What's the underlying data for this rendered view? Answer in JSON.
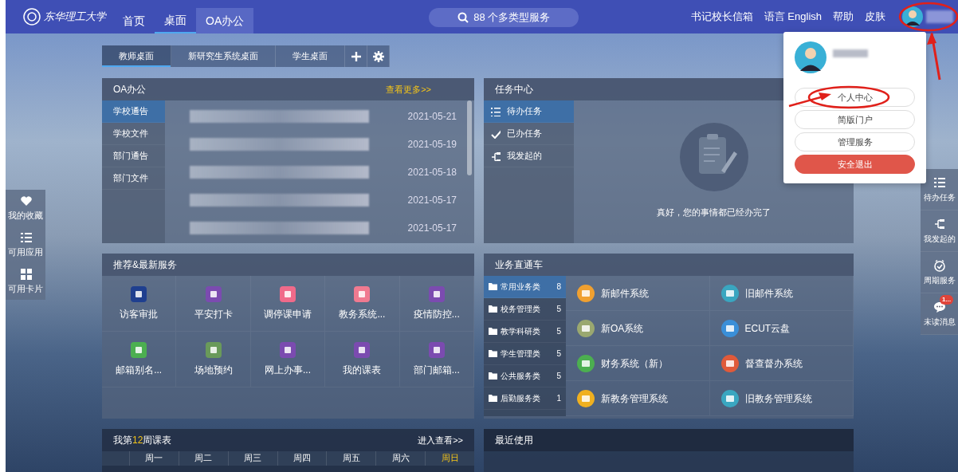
{
  "top_bar": {
    "logo": "东华理工大学",
    "nav": [
      {
        "label": "首页",
        "selected": false,
        "hovered": false
      },
      {
        "label": "桌面",
        "selected": true,
        "hovered": false
      },
      {
        "label": "OA办公",
        "selected": false,
        "hovered": true
      }
    ],
    "search": {
      "placeholder": "88 个多类型服务"
    },
    "links": [
      "书记校长信箱",
      "语言 English",
      "帮助",
      "皮肤"
    ]
  },
  "desk_tabs": [
    {
      "label": "教师桌面",
      "selected": true
    },
    {
      "label": "新研究生系统桌面",
      "selected": false
    },
    {
      "label": "学生桌面",
      "selected": false
    }
  ],
  "oa_panel": {
    "title": "OA办公",
    "more": "查看更多>>",
    "categories": [
      {
        "label": "学校通告",
        "selected": true
      },
      {
        "label": "学校文件",
        "selected": false
      },
      {
        "label": "部门通告",
        "selected": false
      },
      {
        "label": "部门文件",
        "selected": false
      }
    ],
    "items": [
      {
        "date": "2021-05-21"
      },
      {
        "date": "2021-05-19"
      },
      {
        "date": "2021-05-18"
      },
      {
        "date": "2021-05-17"
      },
      {
        "date": "2021-05-17"
      }
    ]
  },
  "task_center": {
    "title": "任务中心",
    "items": [
      {
        "label": "待办任务",
        "kind": "todo",
        "selected": true
      },
      {
        "label": "已办任务",
        "kind": "done",
        "selected": false
      },
      {
        "label": "我发起的",
        "kind": "started",
        "selected": false
      }
    ],
    "empty_message": "真好，您的事情都已经办完了"
  },
  "services": {
    "title": "推荐&最新服务",
    "items": [
      {
        "label": "访客审批",
        "color": "#1f3f8f"
      },
      {
        "label": "平安打卡",
        "color": "#7b4bb0"
      },
      {
        "label": "调停课申请",
        "color": "#f06a8a"
      },
      {
        "label": "教务系统...",
        "color": "#f07a90"
      },
      {
        "label": "疫情防控...",
        "color": "#7b4bb0"
      },
      {
        "label": "邮箱别名...",
        "color": "#4caf50"
      },
      {
        "label": "场地预约",
        "color": "#6a9a5a"
      },
      {
        "label": "网上办事...",
        "color": "#7b4bb0"
      },
      {
        "label": "我的课表",
        "color": "#7b4bb0"
      },
      {
        "label": "部门邮箱...",
        "color": "#7b4bb0"
      }
    ]
  },
  "business": {
    "title": "业务直通车",
    "categories": [
      {
        "label": "常用业务类",
        "count": "8",
        "selected": true
      },
      {
        "label": "校务管理类",
        "count": "5",
        "selected": false
      },
      {
        "label": "教学科研类",
        "count": "5",
        "selected": false
      },
      {
        "label": "学生管理类",
        "count": "5",
        "selected": false
      },
      {
        "label": "公共服务类",
        "count": "5",
        "selected": false
      },
      {
        "label": "后勤服务类",
        "count": "1",
        "selected": false
      }
    ],
    "systems": [
      {
        "label": "新邮件系统",
        "color": "#f0a030"
      },
      {
        "label": "旧邮件系统",
        "color": "#3aa6c0"
      },
      {
        "label": "新OA系统",
        "color": "#9aa870"
      },
      {
        "label": "ECUT云盘",
        "color": "#3a8fd8"
      },
      {
        "label": "财务系统（新）",
        "color": "#4caf50"
      },
      {
        "label": "督查督办系统",
        "color": "#e05a3a"
      },
      {
        "label": "新教务管理系统",
        "color": "#f0b020"
      },
      {
        "label": "旧教务管理系统",
        "color": "#3aa6c0"
      }
    ]
  },
  "schedule": {
    "title_prefix": "我第",
    "week": "12",
    "title_suffix": "周课表",
    "more": "进入查看>>",
    "days": [
      {
        "label": "周一",
        "today": false
      },
      {
        "label": "周二",
        "today": false
      },
      {
        "label": "周三",
        "today": false
      },
      {
        "label": "周四",
        "today": false
      },
      {
        "label": "周五",
        "today": false
      },
      {
        "label": "周六",
        "today": false
      },
      {
        "label": "周日",
        "today": true
      }
    ]
  },
  "recent": {
    "title": "最近使用"
  },
  "left_dock": [
    {
      "label": "我的收藏",
      "kind": "heart"
    },
    {
      "label": "可用应用",
      "kind": "list"
    },
    {
      "label": "可用卡片",
      "kind": "grid"
    }
  ],
  "right_dock": [
    {
      "label": "待办任务",
      "kind": "list"
    },
    {
      "label": "我发起的",
      "kind": "flow"
    },
    {
      "label": "周期服务",
      "kind": "clock"
    },
    {
      "label": "未读消息",
      "kind": "chat",
      "badge": "1..."
    }
  ],
  "user_menu": {
    "open": true,
    "buttons": [
      {
        "label": "个人中心",
        "kind": "default"
      },
      {
        "label": "简版门户",
        "kind": "default"
      },
      {
        "label": "管理服务",
        "kind": "default"
      },
      {
        "label": "安全退出",
        "kind": "danger"
      }
    ]
  },
  "annotations": {
    "avatar_circled": true,
    "menu_item_circled": true
  }
}
